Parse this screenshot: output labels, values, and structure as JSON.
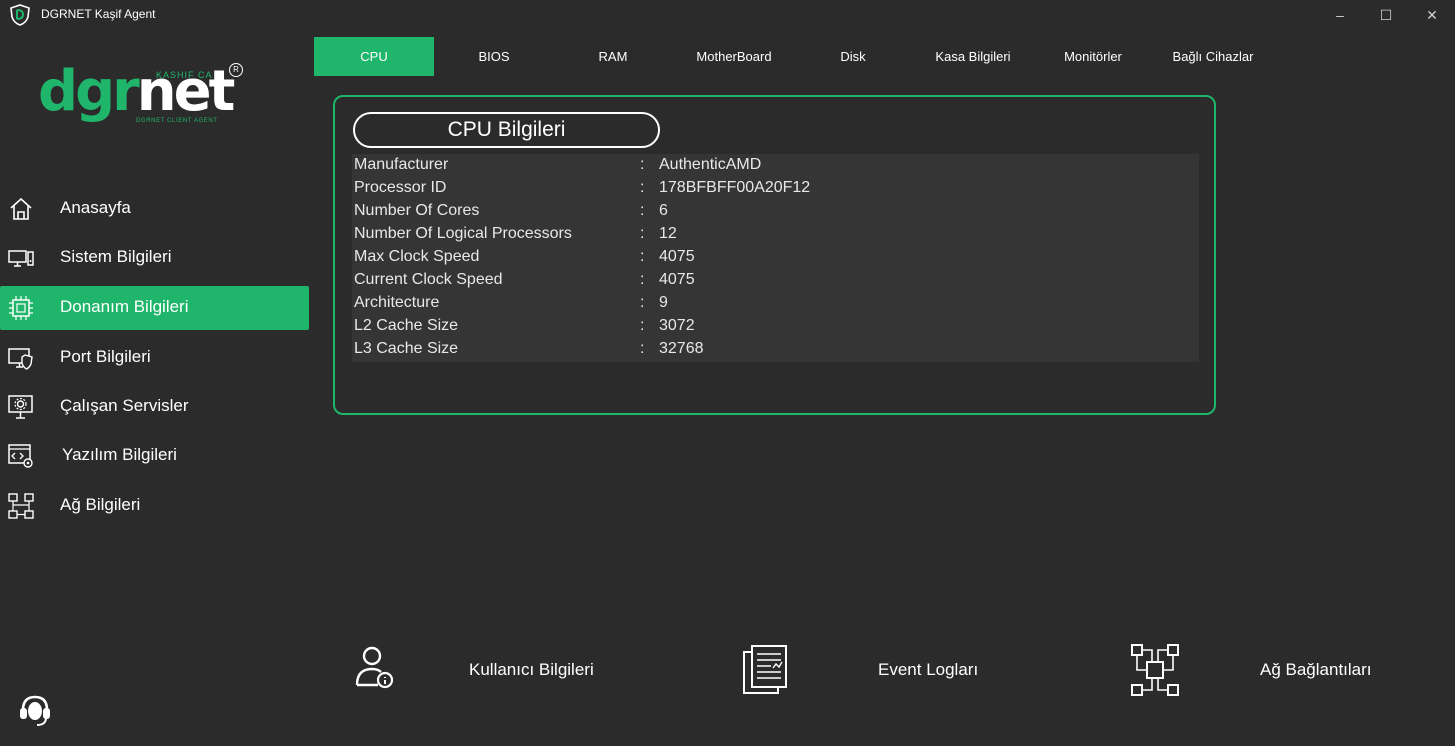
{
  "window": {
    "title": "DGRNET Kaşif Agent",
    "minimize_glyph": "–",
    "maximize_glyph": "☐",
    "close_glyph": "✕"
  },
  "logo": {
    "word_dgr": "dgr",
    "word_net": "net",
    "tagline_top": "KASHIF CA",
    "tagline_bottom": "DGRNET CLIENT AGENT",
    "registered": "R"
  },
  "sidebar": {
    "items": [
      {
        "label": "Anasayfa",
        "icon": "home-icon"
      },
      {
        "label": "Sistem Bilgileri",
        "icon": "computer-icon"
      },
      {
        "label": "Donanım Bilgileri",
        "icon": "chip-icon",
        "active": true
      },
      {
        "label": "Port Bilgileri",
        "icon": "monitor-shield-icon"
      },
      {
        "label": "Çalışan Servisler",
        "icon": "services-gear-icon"
      },
      {
        "label": "Yazılım Bilgileri",
        "icon": "software-code-icon"
      },
      {
        "label": "Ağ Bilgileri",
        "icon": "network-icon"
      }
    ]
  },
  "tabs": [
    {
      "label": "CPU",
      "active": true
    },
    {
      "label": "BIOS"
    },
    {
      "label": "RAM"
    },
    {
      "label": "MotherBoard"
    },
    {
      "label": "Disk"
    },
    {
      "label": "Kasa Bilgileri"
    },
    {
      "label": "Monitörler"
    },
    {
      "label": "Bağlı Cihazlar"
    }
  ],
  "cpu_card": {
    "title": "CPU Bilgileri",
    "separator": ":",
    "rows": [
      {
        "key": "Manufacturer",
        "value": "AuthenticAMD"
      },
      {
        "key": "Processor ID",
        "value": "178BFBFF00A20F12"
      },
      {
        "key": "Number Of Cores",
        "value": "6"
      },
      {
        "key": "Number Of Logical Processors",
        "value": "12"
      },
      {
        "key": "Max Clock Speed",
        "value": "4075"
      },
      {
        "key": "Current Clock Speed",
        "value": "4075"
      },
      {
        "key": "Architecture",
        "value": "9"
      },
      {
        "key": "L2 Cache Size",
        "value": "3072"
      },
      {
        "key": "L3 Cache Size",
        "value": "32768"
      }
    ]
  },
  "shortcuts": [
    {
      "label": "Kullanıcı Bilgileri",
      "icon": "user-info-icon"
    },
    {
      "label": "Event Logları",
      "icon": "event-log-icon"
    },
    {
      "label": "Ağ Bağlantıları",
      "icon": "network-connections-icon"
    }
  ],
  "colors": {
    "accent": "#1fb56a",
    "background": "#2b2b2b",
    "table_background": "#353535"
  }
}
